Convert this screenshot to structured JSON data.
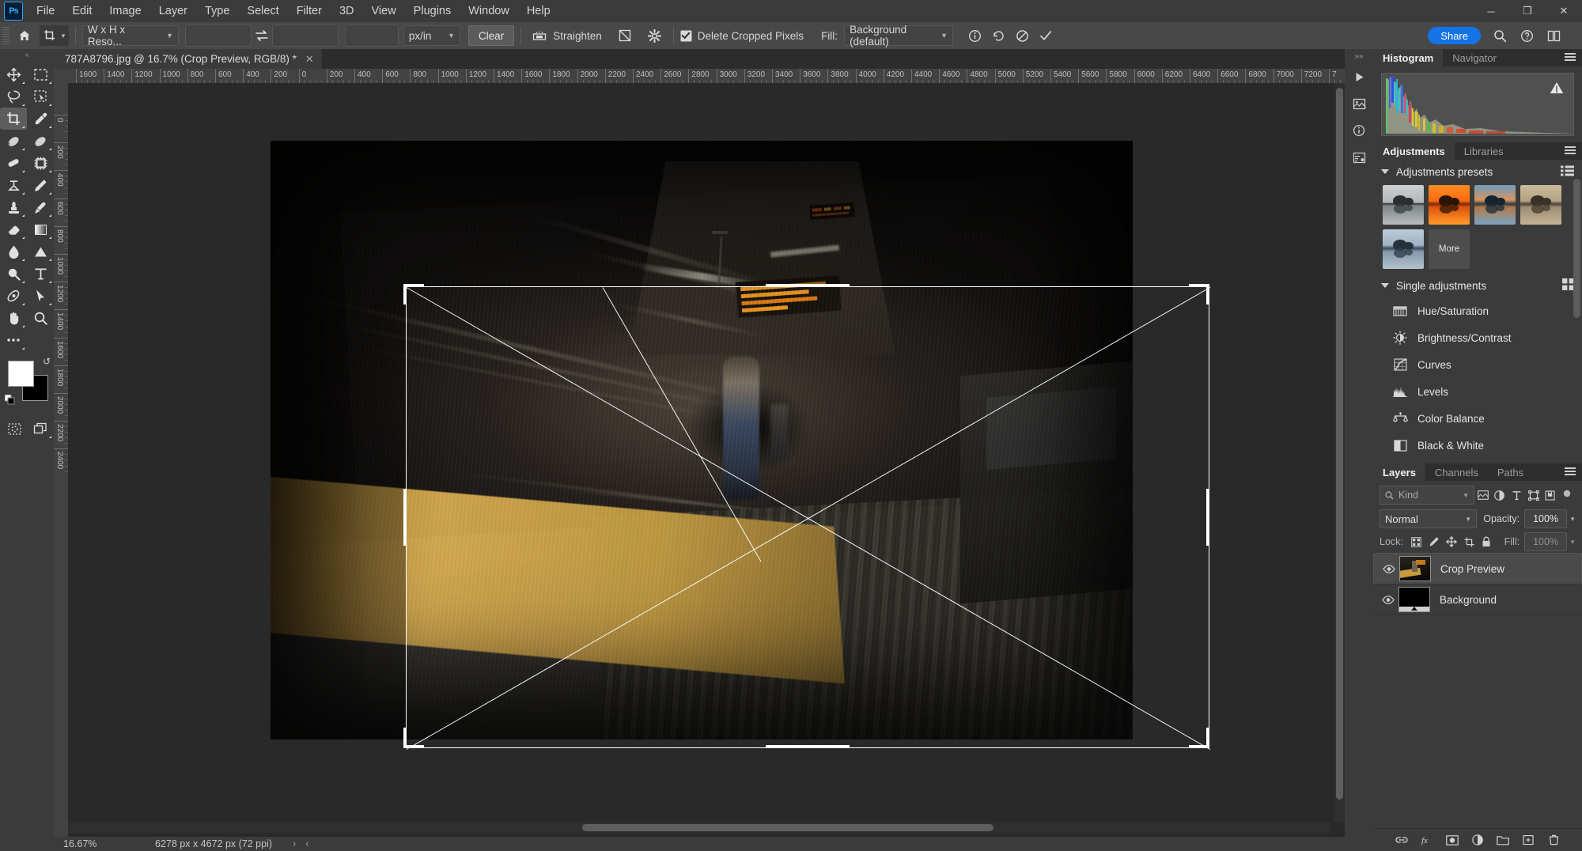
{
  "app": {
    "name": "Adobe Photoshop",
    "logo_text": "Ps"
  },
  "menubar": {
    "items": [
      "File",
      "Edit",
      "Image",
      "Layer",
      "Type",
      "Select",
      "Filter",
      "3D",
      "View",
      "Plugins",
      "Window",
      "Help"
    ],
    "window_controls": {
      "minimize": "─",
      "maximize": "❐",
      "close": "✕"
    }
  },
  "options_bar": {
    "home_icon": "home-icon",
    "tool_icon": "crop-tool-icon",
    "ratio_select": "W x H x Reso...",
    "width_value": "",
    "width_placeholder": "",
    "swap_icon": "swap-arrows-icon",
    "height_value": "",
    "resolution_value": "",
    "unit_select": "px/in",
    "clear_label": "Clear",
    "straighten_icon": "straighten-icon",
    "straighten_label": "Straighten",
    "overlay_icon": "crop-overlay-icon",
    "settings_icon": "gear-icon",
    "delete_cropped_checked": true,
    "delete_cropped_label": "Delete Cropped Pixels",
    "fill_label": "Fill:",
    "fill_select": "Background (default)",
    "info_icon": "info-icon",
    "reset_icon": "reset-icon",
    "cancel_icon": "cancel-icon",
    "commit_icon": "commit-check-icon",
    "share_label": "Share",
    "search_icon": "search-icon",
    "help_icon": "help-icon",
    "arrange_icon": "arrange-icon"
  },
  "toolbar": {
    "tools": [
      [
        "move-tool",
        "rectangular-marquee-tool"
      ],
      [
        "lasso-tool",
        "object-selection-tool"
      ],
      [
        "crop-tool",
        "eyedropper-tool"
      ],
      [
        "spot-healing-brush-tool",
        "healing-brush-tool"
      ],
      [
        "patch-tool",
        "remove-tool"
      ],
      [
        "clone-stamp-tool",
        "pencil-tool"
      ],
      [
        "stamp-tool",
        "history-brush-tool"
      ],
      [
        "eraser-tool",
        "gradient-tool"
      ],
      [
        "blur-tool",
        "dodge-tool"
      ],
      [
        "burn-tool",
        "type-tool"
      ],
      [
        "pen-tool",
        "path-selection-tool"
      ],
      [
        "hand-tool",
        "zoom-tool"
      ],
      [
        "edit-toolbar-tool",
        ""
      ]
    ],
    "active_tool": "crop-tool",
    "foreground_color": "#ffffff",
    "background_color": "#000000",
    "quick_mask_icon": "quick-mask-icon",
    "screen_mode_icon": "screen-mode-icon"
  },
  "document": {
    "tab_title": "787A8796.jpg @ 16.7% (Crop Preview, RGB/8) *",
    "close_glyph": "✕"
  },
  "rulers": {
    "unit": "px",
    "horizontal_ticks": [
      "1600",
      "1400",
      "1200",
      "1000",
      "800",
      "600",
      "400",
      "200",
      "0",
      "200",
      "400",
      "600",
      "800",
      "1000",
      "1200",
      "1400",
      "1600",
      "1800",
      "2000",
      "2200",
      "2400",
      "2600",
      "2800",
      "3000",
      "3200",
      "3400",
      "3600",
      "3800",
      "4000",
      "4200",
      "4400",
      "4600",
      "4800",
      "5000",
      "5200",
      "5400",
      "5600",
      "5800",
      "6000",
      "6200",
      "6400",
      "6600",
      "6800",
      "7000",
      "7200",
      "7"
    ],
    "vertical_ticks": [
      "0",
      "200",
      "400",
      "600",
      "800",
      "1000",
      "1200",
      "1400",
      "1600",
      "1800",
      "2000",
      "2200",
      "2400"
    ]
  },
  "status_bar": {
    "zoom": "16.67%",
    "doc_info": "6278 px x 4672 px (72 ppi)",
    "next_glyph": "›",
    "prev_glyph": "‹"
  },
  "dock_icons": [
    "collapse-panels-icon",
    "play-icon",
    "library-photos-icon",
    "info-icon",
    "histogram-dock-icon"
  ],
  "histogram_panel": {
    "tabs": [
      {
        "label": "Histogram",
        "active": true
      },
      {
        "label": "Navigator",
        "active": false
      }
    ],
    "menu_icon": "panel-menu-icon",
    "warning_icon": "cached-data-warning-icon"
  },
  "adjustments_panel": {
    "tabs": [
      {
        "label": "Adjustments",
        "active": true
      },
      {
        "label": "Libraries",
        "active": false
      }
    ],
    "menu_icon": "panel-menu-icon",
    "presets_section": {
      "label": "Adjustments presets",
      "view_icon": "list-view-icon",
      "more_label": "More",
      "cards": [
        {
          "name": "preset-bw",
          "colors": [
            "#c9ccce",
            "#9ca1a4",
            "#3d4244"
          ]
        },
        {
          "name": "preset-warm-sunset",
          "colors": [
            "#ff7a18",
            "#e85d10",
            "#c33c06"
          ]
        },
        {
          "name": "preset-cool-dusk",
          "colors": [
            "#8fb4cf",
            "#d98b5a",
            "#2e3d4c"
          ]
        },
        {
          "name": "preset-sepia",
          "colors": [
            "#c8b69a",
            "#a08f72",
            "#5a5041"
          ]
        },
        {
          "name": "preset-cool-blue",
          "colors": [
            "#b8c8d6",
            "#8ea2b5",
            "#47566a"
          ]
        }
      ]
    },
    "single_section": {
      "label": "Single adjustments",
      "view_icon": "grid-view-icon",
      "items": [
        {
          "label": "Hue/Saturation",
          "icon": "hue-saturation-icon"
        },
        {
          "label": "Brightness/Contrast",
          "icon": "brightness-contrast-icon"
        },
        {
          "label": "Curves",
          "icon": "curves-icon"
        },
        {
          "label": "Levels",
          "icon": "levels-icon"
        },
        {
          "label": "Color Balance",
          "icon": "color-balance-icon"
        },
        {
          "label": "Black & White",
          "icon": "black-and-white-icon"
        }
      ]
    }
  },
  "layers_panel": {
    "tabs": [
      {
        "label": "Layers",
        "active": true
      },
      {
        "label": "Channels",
        "active": false
      },
      {
        "label": "Paths",
        "active": false
      }
    ],
    "menu_icon": "panel-menu-icon",
    "filter": {
      "search_icon": "search-icon",
      "kind_label": "Kind",
      "icons": [
        "filter-pixel-icon",
        "filter-adjustment-icon",
        "filter-type-icon",
        "filter-shape-icon",
        "filter-smart-object-icon"
      ],
      "toggle_icon": "filter-toggle-icon"
    },
    "blend_mode": "Normal",
    "opacity_label": "Opacity:",
    "opacity_value": "100%",
    "lock_label": "Lock:",
    "lock_icons": [
      "lock-transparent-pixels-icon",
      "lock-image-pixels-icon",
      "lock-position-icon",
      "lock-artboard-icon",
      "lock-all-icon"
    ],
    "fill_label": "Fill:",
    "fill_value": "100%",
    "layers": [
      {
        "name": "Crop Preview",
        "visible": true,
        "selected": true,
        "thumb": "photo-thumb"
      },
      {
        "name": "Background",
        "visible": true,
        "selected": false,
        "thumb": "black-thumb"
      }
    ],
    "footer_icons": [
      "link-layers-icon",
      "layer-style-icon",
      "add-layer-mask-icon",
      "new-adjustment-layer-icon",
      "new-group-icon",
      "new-layer-icon",
      "delete-layer-icon"
    ]
  },
  "colors": {
    "accent_blue": "#1473e6",
    "panel_bg": "#3b3b3b",
    "options_bg": "#484848",
    "canvas_bg": "#292929",
    "text": "#e4e4e4"
  }
}
